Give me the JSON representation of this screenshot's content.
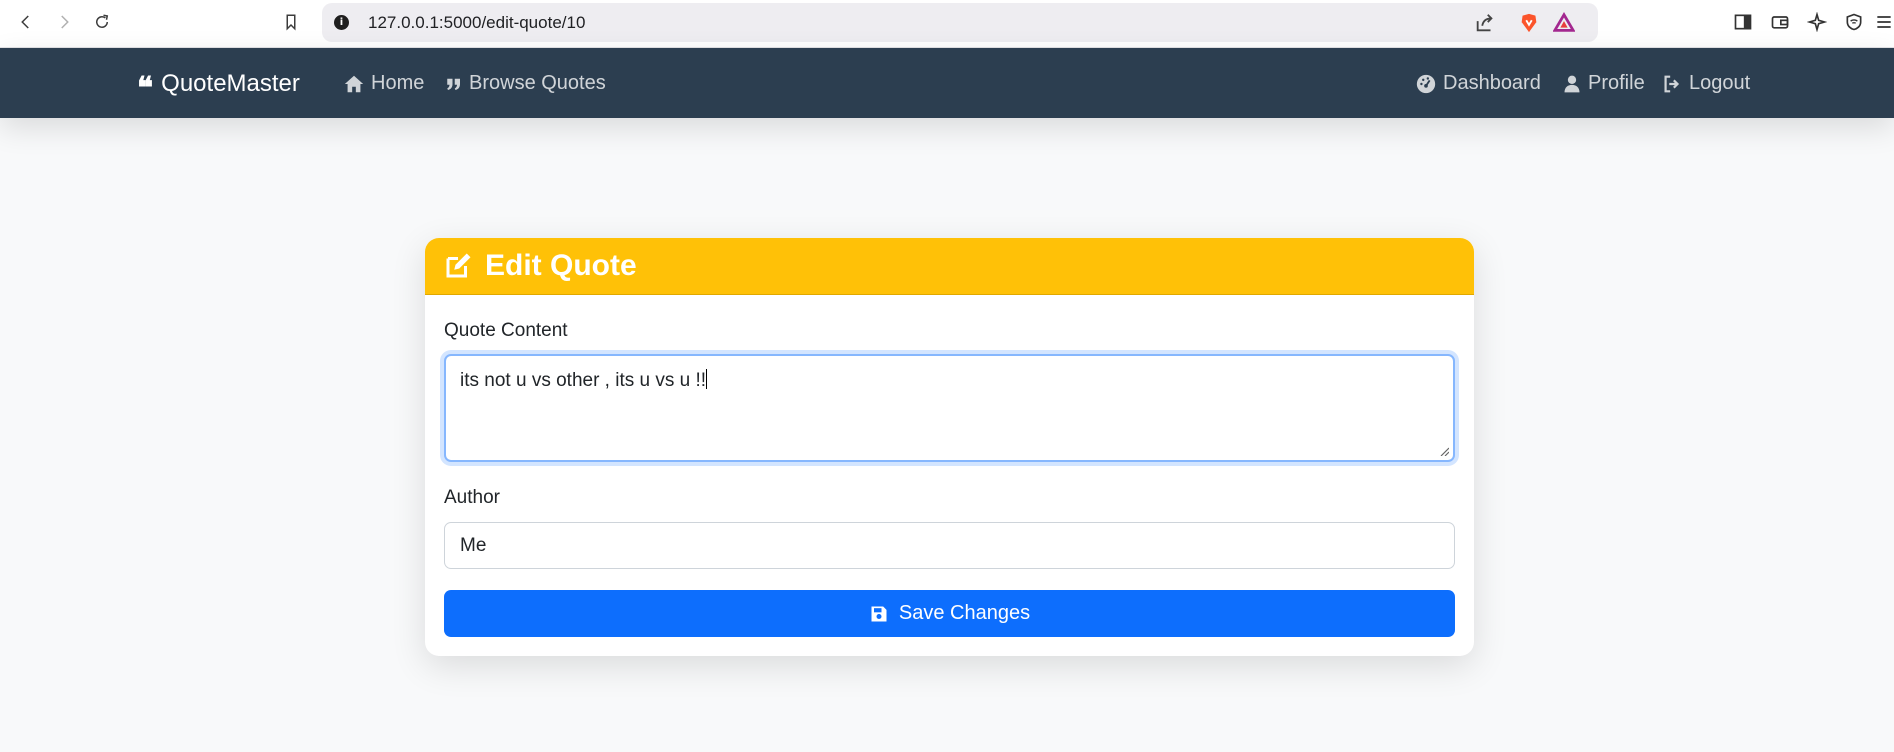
{
  "browser": {
    "url": "127.0.0.1:5000/edit-quote/10",
    "icons": [
      "back-icon",
      "forward-icon",
      "reload-icon",
      "bookmark-icon",
      "site-info-icon",
      "share-icon",
      "brave-shield-icon",
      "brave-rewards-icon",
      "sidebar-icon",
      "wallet-icon",
      "leo-ai-icon",
      "vpn-icon",
      "menu-icon"
    ]
  },
  "navbar": {
    "brand": "QuoteMaster",
    "links": [
      {
        "label": "Home",
        "icon": "home-icon"
      },
      {
        "label": "Browse Quotes",
        "icon": "quote-icon"
      },
      {
        "label": "Dashboard",
        "icon": "dashboard-icon"
      },
      {
        "label": "Profile",
        "icon": "user-icon"
      },
      {
        "label": "Logout",
        "icon": "logout-icon"
      }
    ]
  },
  "card": {
    "title": "Edit Quote",
    "title_icon": "edit-icon",
    "content_label": "Quote Content",
    "content_value": "its not u vs other , its u vs u !!",
    "author_label": "Author",
    "author_value": "Me",
    "save_label": "Save Changes",
    "save_icon": "save-icon"
  },
  "colors": {
    "navbar": "#2c3e50",
    "header": "#ffc107",
    "primary": "#0d6efd",
    "page_bg": "#f8f9fa"
  }
}
